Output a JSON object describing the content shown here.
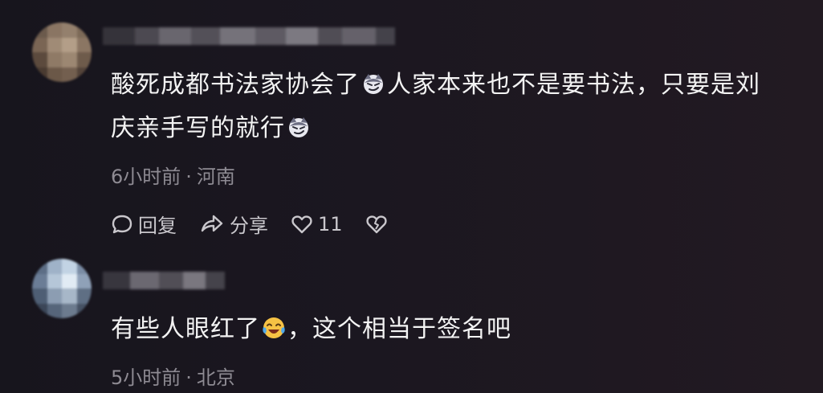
{
  "comments": [
    {
      "text_line1": "酸死成都书法家协会了",
      "text_line1_after": "人家本来也不是要书法，只要是刘",
      "text_line2": "庆亲手写的就行",
      "time": "6小时前",
      "dot": "·",
      "location": "河南",
      "reply_label": "回复",
      "share_label": "分享",
      "like_count": "11",
      "emoji": "smirk-emoji"
    },
    {
      "text_before": "有些人眼红了",
      "text_after": "，这个相当于签名吧",
      "time": "5小时前",
      "dot": "·",
      "location": "北京",
      "emoji": "crying-laughing-emoji"
    }
  ],
  "colors": {
    "background": "#1b1720",
    "text": "#f3f3f3",
    "meta": "#8e8b93",
    "action": "#c9c7cc"
  }
}
